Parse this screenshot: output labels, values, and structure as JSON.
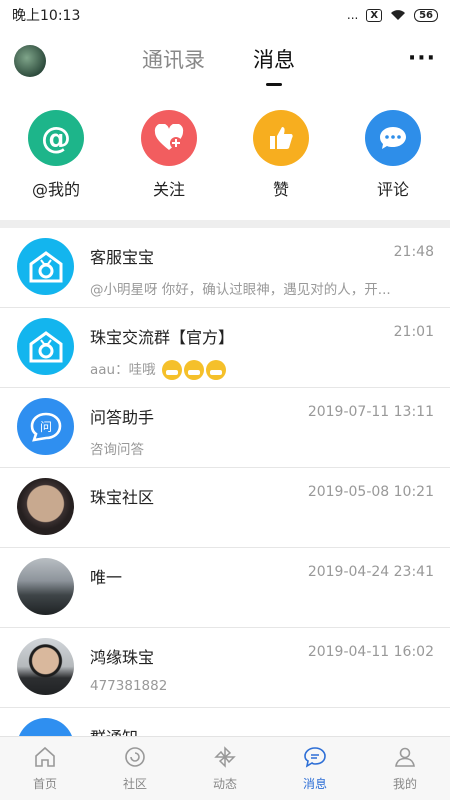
{
  "status_bar": {
    "time": "晚上10:13",
    "signal_dots": "...",
    "box_icon": "X",
    "battery": "56"
  },
  "header": {
    "tabs": [
      {
        "label": "通讯录"
      },
      {
        "label": "消息"
      }
    ],
    "active_tab": "消息",
    "more": "···"
  },
  "quick_actions": [
    {
      "label": "@我的",
      "icon": "at-icon",
      "color": "#1db58a",
      "glyph": "@"
    },
    {
      "label": "关注",
      "icon": "heart-plus-icon",
      "color": "#f25d5f"
    },
    {
      "label": "赞",
      "icon": "thumbs-up-icon",
      "color": "#f7ae1f"
    },
    {
      "label": "评论",
      "icon": "comment-icon",
      "color": "#2e8ee9"
    }
  ],
  "messages": [
    {
      "name": "客服宝宝",
      "time": "21:48",
      "preview": "@小明星呀 你好，确认过眼神，遇见对的人，开..."
    },
    {
      "name": "珠宝交流群【官方】",
      "time": "21:01",
      "preview": "aau：哇哦"
    },
    {
      "name": "问答助手",
      "time": "2019-07-11 13:11",
      "preview": "咨询问答",
      "avatar_glyph": "问"
    },
    {
      "name": "珠宝社区",
      "time": "2019-05-08 10:21",
      "preview": ""
    },
    {
      "name": "唯一",
      "time": "2019-04-24 23:41",
      "preview": ""
    },
    {
      "name": "鸿缘珠宝",
      "time": "2019-04-11 16:02",
      "preview": "477381882"
    },
    {
      "name": "群通知",
      "time": "",
      "preview": ""
    }
  ],
  "bottom_nav": [
    {
      "label": "首页",
      "icon": "home-icon"
    },
    {
      "label": "社区",
      "icon": "community-icon"
    },
    {
      "label": "动态",
      "icon": "pinwheel-icon"
    },
    {
      "label": "消息",
      "icon": "message-icon",
      "active": true
    },
    {
      "label": "我的",
      "icon": "profile-icon"
    }
  ],
  "colors": {
    "active": "#2e6fd6",
    "divider": "#eeeeee"
  }
}
